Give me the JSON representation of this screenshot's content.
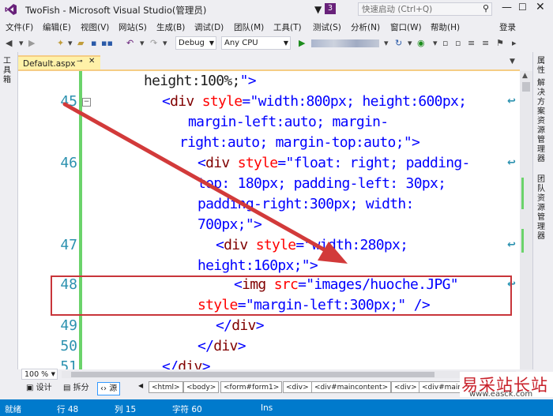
{
  "window": {
    "title": "TwoFish - Microsoft Visual Studio(管理员)",
    "notification_count": "3",
    "quick_launch_placeholder": "快速启动 (Ctrl+Q)"
  },
  "menu": [
    "文件(F)",
    "编辑(E)",
    "视图(V)",
    "网站(S)",
    "生成(B)",
    "调试(D)",
    "团队(M)",
    "工具(T)",
    "测试(S)",
    "分析(N)",
    "窗口(W)",
    "帮助(H)"
  ],
  "login": "登录",
  "toolbar": {
    "config": "Debug",
    "platform": "Any CPU"
  },
  "left_panel": "工具箱",
  "right_panels": [
    "属性",
    "解决方案资源管理器",
    "团队资源管理器"
  ],
  "doc_tab": {
    "name": "Default.aspx"
  },
  "code_lines": [
    {
      "ln": "",
      "segs": [
        [
          "x",
          "height:100%;"
        ],
        [
          "s",
          "\">"
        ]
      ]
    },
    {
      "ln": "45",
      "segs": [
        [
          "p",
          "<"
        ],
        [
          "t",
          "div"
        ],
        [
          "x",
          " "
        ],
        [
          "a",
          "style"
        ],
        [
          "p",
          "="
        ],
        [
          "s",
          "\"width:800px; height:600px;"
        ]
      ]
    },
    {
      "ln": "",
      "segs": [
        [
          "s",
          "margin-left:auto; margin-"
        ]
      ]
    },
    {
      "ln": "",
      "segs": [
        [
          "s",
          "right:auto; margin-top:auto;\""
        ],
        [
          "p",
          ">"
        ]
      ]
    },
    {
      "ln": "46",
      "segs": [
        [
          "p",
          "<"
        ],
        [
          "t",
          "div"
        ],
        [
          "x",
          " "
        ],
        [
          "a",
          "style"
        ],
        [
          "p",
          "="
        ],
        [
          "s",
          "\"float: right; padding-"
        ]
      ]
    },
    {
      "ln": "",
      "segs": [
        [
          "s",
          "top: 180px; padding-left: 30px;"
        ]
      ]
    },
    {
      "ln": "",
      "segs": [
        [
          "s",
          "padding-right:300px; width:"
        ]
      ]
    },
    {
      "ln": "",
      "segs": [
        [
          "s",
          "700px;\""
        ],
        [
          "p",
          ">"
        ]
      ]
    },
    {
      "ln": "47",
      "segs": [
        [
          "p",
          "<"
        ],
        [
          "t",
          "div"
        ],
        [
          "x",
          " "
        ],
        [
          "a",
          "style"
        ],
        [
          "p",
          "="
        ],
        [
          "s",
          "\"width:280px;"
        ]
      ]
    },
    {
      "ln": "",
      "segs": [
        [
          "s",
          "height:160px;\""
        ],
        [
          "p",
          ">"
        ]
      ]
    },
    {
      "ln": "48",
      "segs": [
        [
          "p",
          "<"
        ],
        [
          "t",
          "img"
        ],
        [
          "x",
          " "
        ],
        [
          "a",
          "src"
        ],
        [
          "p",
          "="
        ],
        [
          "s",
          "\"images/huoche.JPG\""
        ]
      ]
    },
    {
      "ln": "",
      "segs": [
        [
          "a",
          "style"
        ],
        [
          "p",
          "="
        ],
        [
          "s",
          "\"margin-left:300px;\""
        ],
        [
          "x",
          " "
        ],
        [
          "p",
          "/>"
        ]
      ]
    },
    {
      "ln": "49",
      "segs": [
        [
          "p",
          "</"
        ],
        [
          "t",
          "div"
        ],
        [
          "p",
          ">"
        ]
      ]
    },
    {
      "ln": "50",
      "segs": [
        [
          "p",
          "</"
        ],
        [
          "t",
          "div"
        ],
        [
          "p",
          ">"
        ]
      ]
    },
    {
      "ln": "51",
      "segs": [
        [
          "p",
          "</"
        ],
        [
          "t",
          "div"
        ],
        [
          "p",
          ">"
        ]
      ]
    }
  ],
  "zoom": "100 %",
  "view_buttons": [
    "设计",
    "拆分",
    "源"
  ],
  "breadcrumbs": [
    "<html>",
    "<body>",
    "<form#form1>",
    "<div>",
    "<div#maincontent>",
    "<div>",
    "<div#mainco"
  ],
  "status": {
    "ready": "就绪",
    "line": "行 48",
    "col": "列 15",
    "char": "字符 60",
    "mode": "Ins"
  },
  "watermark": {
    "text": "易采站长站",
    "url": "www.easck.com"
  }
}
